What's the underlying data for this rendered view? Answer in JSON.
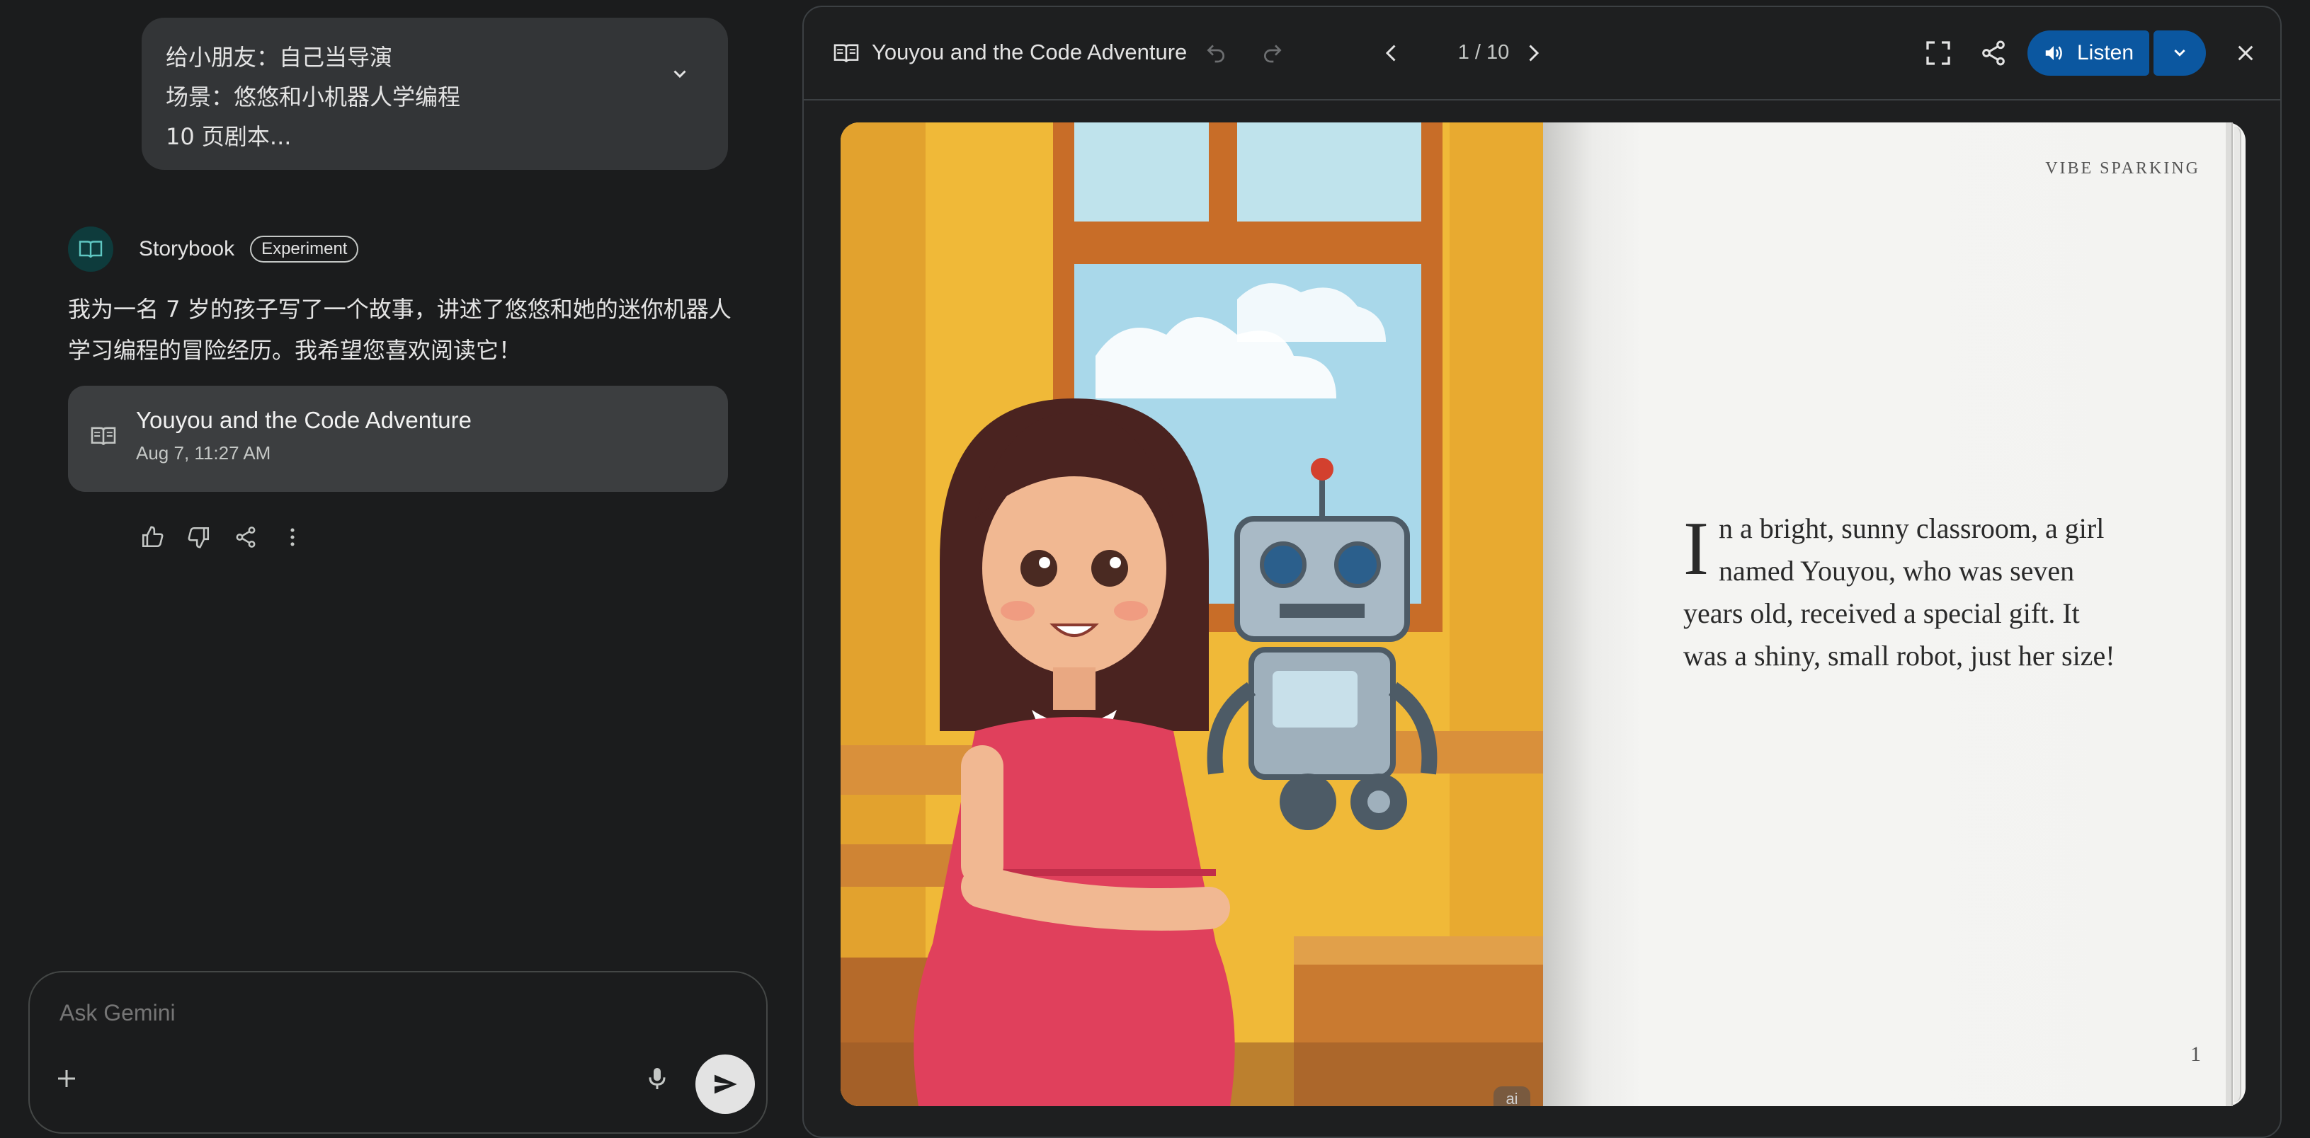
{
  "chat": {
    "user_prompt_lines": [
      "给小朋友：自己当导演",
      "场景：悠悠和小机器人学编程",
      "10 页剧本..."
    ],
    "model_name": "Storybook",
    "badge": "Experiment",
    "response_text_lines": [
      "我为一名 7 岁的孩子写了一个故事，讲述了悠悠和她的迷你机器人",
      "学习编程的冒险经历。我希望您喜欢阅读它！"
    ],
    "story_card": {
      "title": "Youyou and the Code Adventure",
      "date": "Aug 7, 11:27 AM"
    },
    "actions": [
      "thumbs-up-icon",
      "thumbs-down-icon",
      "share-icon",
      "more-vert-icon"
    ]
  },
  "input": {
    "placeholder": "Ask Gemini"
  },
  "viewer": {
    "title": "Youyou and the Code Adventure",
    "page_indicator": "1 / 10",
    "listen_label": "Listen",
    "running_head": "VIBE SPARKING",
    "dropcap": "I",
    "story_text": "n a bright, sunny classroom, a girl named Youyou, who was seven years old, received a special gift. It was a shiny, small robot, just her size!",
    "page_number": "1",
    "ai_badge": "ai"
  },
  "colors": {
    "background": "#1b1c1d",
    "bubble": "#333537",
    "card": "#3c3e40",
    "listen_button": "#0b57a0",
    "page": "#f3f3f1"
  }
}
